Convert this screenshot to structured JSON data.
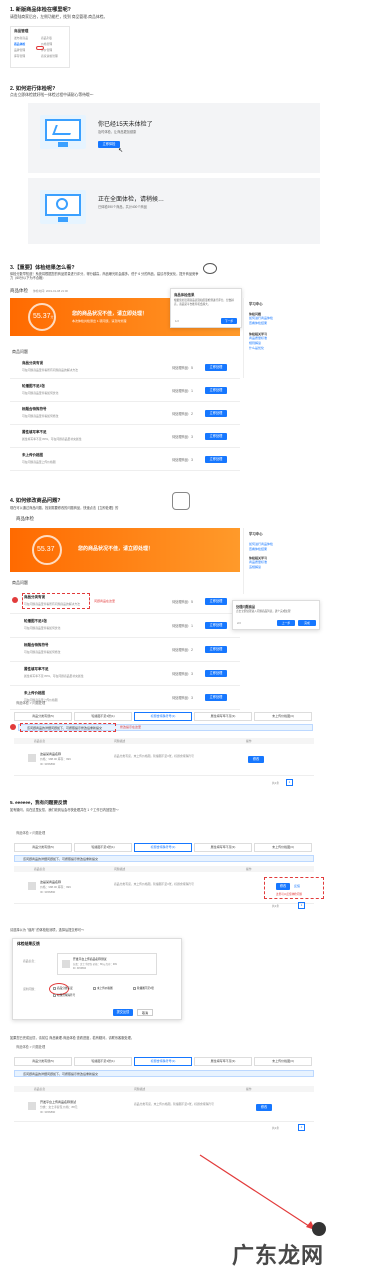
{
  "s1": {
    "title": "1. 新版商品体检在哪里呢?",
    "desc": "请登陆商家后台，左侧功能栏，找到 商品管理-商品体检。",
    "menu": {
      "header": "商品管理",
      "items": [
        "发布新商品",
        "商品列表",
        "商品体检",
        "价格管理",
        "品牌管理",
        "评价管理",
        "库存管理",
        "商家资格管理"
      ]
    }
  },
  "s2": {
    "title": "2. 如何进行体检呢?",
    "desc": "点击立即体检就好啦～体检过程中请耐心等待哦～",
    "card1": {
      "title": "你已经15天未体检了",
      "sub": "及时体检，让商品更加健康",
      "button": "立即体检"
    },
    "card2": {
      "title": "正在全面体检，请稍候…",
      "sub": "已体检390个商品，共计400个商品"
    }
  },
  "s3": {
    "title": "3.【重要】体检结果怎么看?",
    "desc": "体检分数早知道！系统将根据您的商品质量进行评分，得分越高，商品曝光机会越多。低于 6 分的商品，建议尽快优化，提升商品竞争力（60分以下为不合格）",
    "page_title": "商品体检",
    "page_sub": "体检时间: 2019-01-08 21:00",
    "score": "55.37",
    "score_unit": "分",
    "banner_title": "您的商品状况不佳，请立即处理！",
    "banner_sub": "本次体检共检测出 1 项问题，请及时处理",
    "popup_title": "商品体检结果",
    "popup_text": "根据您的近期商品表现和质量检测进行评分，分数越高，商品受平台推荐机会越大。",
    "popup_next": "下一步",
    "popup_page": "1/2",
    "side_title": "学习中心",
    "side_head1": "体检问题",
    "side_links1": [
      "如何进行商品体检",
      "查看体检结果"
    ],
    "side_head2": "体检相关学习",
    "side_links2": [
      "商品质量标准",
      "规则解读",
      "什么是优化"
    ],
    "list_title": "商品问题",
    "items": [
      {
        "name": "商品分类有误",
        "desc": "可在问题商品里查看所有问题商品的解决方法",
        "count": "待处理商品：5",
        "btn": "立即处理"
      },
      {
        "name": "轮播图不足3张",
        "desc": "可在问题商品里查看如何优化",
        "count": "待处理商品：1",
        "btn": "立即处理"
      },
      {
        "name": "标题含特殊符号",
        "desc": "可在问题商品里查看如何修改",
        "count": "待处理商品：2",
        "btn": "立即处理"
      },
      {
        "name": "属性填写率不足",
        "desc": "属性填写率不足 80%，可在问题商品里补充属性",
        "count": "待处理商品：3",
        "btn": "立即处理"
      },
      {
        "name": "未上传价格图",
        "desc": "可在问题商品里上传价格图",
        "count": "待处理商品：3",
        "btn": "立即处理"
      }
    ]
  },
  "s4": {
    "title": "4. 如何修改商品问题?",
    "desc": "现在可以通过商品问题，找到需要修改的问题商品，快速点击【立即处理】的",
    "page_title": "商品体检",
    "score": "55.37",
    "banner_title": "您的商品状况不佳，请立即处理！",
    "side_title": "学习中心",
    "side_links": [
      "如何进行商品体检",
      "查看体检结果",
      "体检相关学习",
      "商品质量标准",
      "违规解读"
    ],
    "highlight_note": "问题商品在这里",
    "popup_title": "处理问题商品",
    "popup_text": "点击立即处理进入问题商品列表，逐个完成处理",
    "popup_prev": "上一步",
    "popup_done": "完成",
    "popup_page": "2/2"
  },
  "s4b": {
    "crumb": "商品体检 > 问题处理",
    "tabs": [
      "商品分类有误(5)",
      "轮播图不足3张(1)",
      "标题含特殊符号(2)",
      "属性填写率不足(3)",
      "未上传价格图(3)"
    ],
    "info": "该问题商品的详细问题如下，可按照提示修改后重新提交",
    "info_note": "修改提示在这里",
    "cols": [
      "商品信息",
      "问题描述",
      "操作"
    ],
    "product": "这是某商品名称",
    "product_sub": "价格：¥88.00 库存：999",
    "product_id": "ID: 3456890",
    "issue": "商品分类有误，未上传价格图，轮播图不足3张，标题含特殊符号",
    "op": "修改",
    "pager_total": "共1条",
    "pager_page": "1"
  },
  "s5": {
    "title": "5. eeeeee，我有问题要反馈",
    "desc": "如有疑问，请在这里反馈，我们收到后会尽快处理并在 1 个工作日内回复您～",
    "crumb": "商品体检 > 问题处理",
    "tabs": [
      "商品分类有误(5)",
      "轮播图不足3张(1)",
      "标题含特殊符号(2)",
      "属性填写率不足(3)",
      "未上传价格图(3)"
    ],
    "info": "该问题商品的详细问题如下，可按照提示修改后重新提交",
    "cols": [
      "商品信息",
      "问题描述",
      "操作"
    ],
    "product": "这是某商品名称",
    "product_sub": "价格：¥88.00 库存：999",
    "product_id": "ID: 3456890",
    "issue": "商品分类有误，未上传价格图，轮播图不足3张，标题含特殊符号",
    "op1": "修改",
    "op2": "反馈",
    "feedback_note": "这里可以反馈体检问题",
    "pager_total": "共1条",
    "pager_page": "1"
  },
  "s5b": {
    "desc": "请选择以为 \"误判\" 的体检检测项，选择后提交即可～",
    "dialog_title": "体检结果反馈",
    "label_goods": "商品信息：",
    "goods_name": "开发平台上传商品名称测试",
    "goods_sub": "分类：女士手提包 价格：88元 库存：999",
    "goods_id": "ID: 3456890",
    "label_reason": "误判问题：",
    "options": [
      "商品分类有误",
      "未上传价格图",
      "轮播图不足3张",
      "标题含特殊符号"
    ],
    "submit": "提交反馈",
    "cancel": "取消"
  },
  "s6": {
    "desc": "如果您已完成反馈，请前往 商品管理-商品体检 查看进度，若有疑问，请联系客服处理。",
    "crumb": "商品体检 > 问题处理",
    "tabs": [
      "商品分类有误(5)",
      "轮播图不足3张(1)",
      "标题含特殊符号(2)",
      "属性填写率不足(3)",
      "未上传价格图(3)"
    ],
    "info": "该问题商品的详细问题如下，可按照提示修改后重新提交",
    "cols": [
      "商品信息",
      "问题描述",
      "操作"
    ],
    "product": "开发平台上传商品名称测试",
    "product_sub": "分类：女士手提包 价格：88元",
    "product_id": "ID: 3456890",
    "issue": "商品分类有误，未上传价格图，轮播图不足3张，标题含特殊符号",
    "op": "修改",
    "pager_total": "共1条",
    "pager_page": "1"
  },
  "watermark": "广东龙网"
}
